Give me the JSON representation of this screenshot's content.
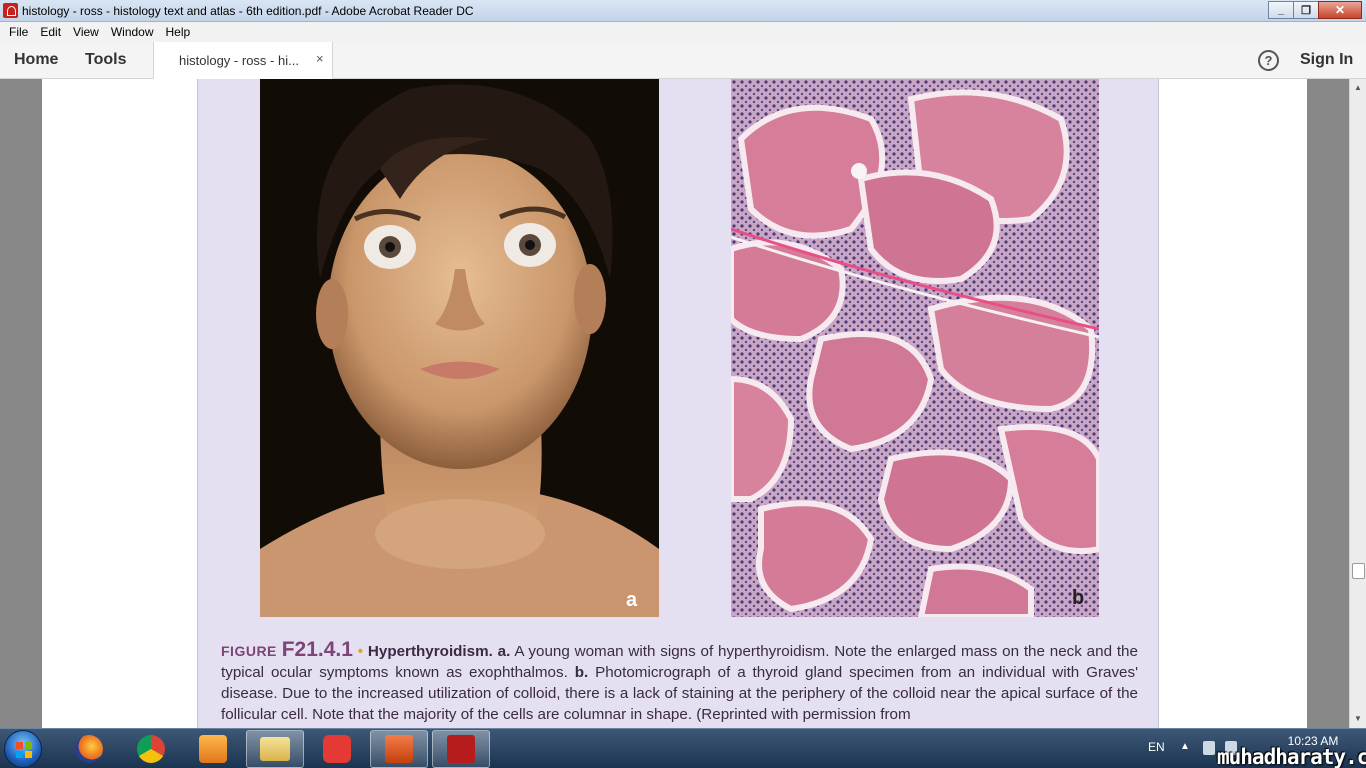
{
  "window": {
    "title": "histology - ross - histology text and atlas - 6th edition.pdf - Adobe Acrobat Reader DC"
  },
  "menu": [
    "File",
    "Edit",
    "View",
    "Window",
    "Help"
  ],
  "toolbar": {
    "home": "Home",
    "tools": "Tools",
    "doc_tab": "histology - ross - hi...",
    "close_glyph": "×",
    "help_glyph": "?",
    "sign_in": "Sign In"
  },
  "figure": {
    "panel_a": "a",
    "panel_b": "b",
    "label": "FIGURE",
    "number": "F21.4.1",
    "bullet": "•",
    "title": "Hyperthyroidism.",
    "part_a": "a.",
    "text_a": "A young woman with signs of hyperthyroidism. Note the enlarged mass on the neck and the typical ocular symptoms known as exophthalmos.",
    "part_b": "b.",
    "text_b": "Photomicrograph of a thyroid gland specimen from an individual with Graves' disease. Due to the increased utilization of colloid, there is a lack of staining at the periphery of the colloid near the apical surface of the follicular cell. Note that the majority of the cells are columnar in shape. (Reprinted with permission from"
  },
  "taskbar": {
    "apps": [
      "firefox-icon",
      "chrome-icon",
      "media-player-icon",
      "file-explorer-icon",
      "app-icon",
      "powerpoint-icon",
      "acrobat-icon"
    ],
    "active_app": "acrobat-icon",
    "language": "EN",
    "time": "10:23 AM"
  },
  "watermark": "muhadharaty.com",
  "colors": {
    "figure_accent": "#7c4478",
    "bullet": "#e3a227",
    "panel_bg": "#e4e0f1"
  }
}
